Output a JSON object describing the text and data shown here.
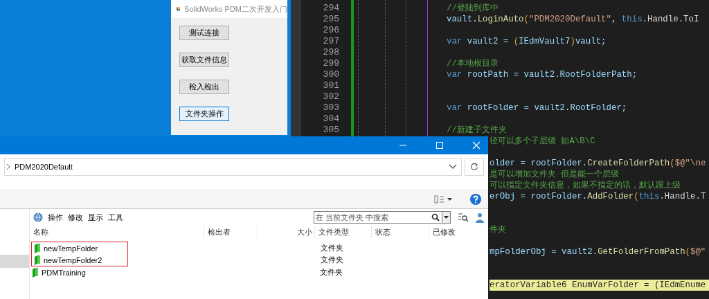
{
  "form_window": {
    "title": "SolidWorks PDM二次开发入门",
    "buttons": [
      {
        "label": "测试连接",
        "focused": false
      },
      {
        "label": "获取文件信息",
        "focused": false
      },
      {
        "label": "检入检出",
        "focused": false
      },
      {
        "label": "文件夹操作",
        "focused": true
      }
    ]
  },
  "code_editor": {
    "lines": [
      {
        "number": "294",
        "tokens": [
          {
            "text": "//登陆到库中",
            "kind": "comment"
          }
        ]
      },
      {
        "number": "295",
        "tokens": [
          {
            "text": "vault",
            "kind": "ident"
          },
          {
            "text": ".",
            "kind": "plain"
          },
          {
            "text": "LoginAuto",
            "kind": "method"
          },
          {
            "text": "(",
            "kind": "paren"
          },
          {
            "text": "\"PDM2020Default\"",
            "kind": "string"
          },
          {
            "text": ", ",
            "kind": "plain"
          },
          {
            "text": "this",
            "kind": "keyword"
          },
          {
            "text": ".Handle.ToI",
            "kind": "plain"
          }
        ]
      },
      {
        "number": "296"
      },
      {
        "number": "297",
        "tokens": [
          {
            "text": "var",
            "kind": "keyword"
          },
          {
            "text": " vault2 = ",
            "kind": "ident"
          },
          {
            "text": "(",
            "kind": "paren"
          },
          {
            "text": "IEdmVault7",
            "kind": "ident"
          },
          {
            "text": ")",
            "kind": "paren"
          },
          {
            "text": "vault;",
            "kind": "ident"
          }
        ]
      },
      {
        "number": "298"
      },
      {
        "number": "299",
        "tokens": [
          {
            "text": "//本地根目录",
            "kind": "comment"
          }
        ]
      },
      {
        "number": "300",
        "tokens": [
          {
            "text": "var",
            "kind": "keyword"
          },
          {
            "text": " rootPath = vault2.RootFolderPath;",
            "kind": "ident"
          }
        ]
      },
      {
        "number": "301"
      },
      {
        "number": "302"
      },
      {
        "number": "303",
        "tokens": [
          {
            "text": "var",
            "kind": "keyword"
          },
          {
            "text": " rootFolder = vault2.RootFolder;",
            "kind": "ident"
          }
        ]
      },
      {
        "number": "304"
      },
      {
        "number": "305",
        "tokens": [
          {
            "text": "//新建子文件夹",
            "kind": "comment"
          }
        ]
      }
    ],
    "partial_lines": [
      {
        "highlighted": false,
        "tokens": [
          {
            "text": "径可以多个子层级 如A\\B\\C",
            "kind": "comment"
          }
        ]
      },
      {
        "highlighted": false,
        "tokens": [
          {
            "text": "older = rootFolder.",
            "kind": "ident"
          },
          {
            "text": "CreateFolderPath",
            "kind": "method"
          },
          {
            "text": "(",
            "kind": "paren"
          },
          {
            "text": "$@\"\\ne",
            "kind": "string"
          }
        ]
      },
      {
        "highlighted": false,
        "tokens": [
          {
            "text": "是可以增加文件夹 但是能一个层级",
            "kind": "comment"
          }
        ]
      },
      {
        "highlighted": false,
        "tokens": [
          {
            "text": "可以指定文件夹信息，如果不指定的话，默认跟上级",
            "kind": "comment"
          }
        ]
      },
      {
        "highlighted": false,
        "tokens": [
          {
            "text": "erObj = rootFolder.",
            "kind": "ident"
          },
          {
            "text": "AddFolder",
            "kind": "method"
          },
          {
            "text": "(",
            "kind": "paren"
          },
          {
            "text": "this",
            "kind": "keyword"
          },
          {
            "text": ".Handle.T",
            "kind": "plain"
          }
        ]
      },
      {
        "highlighted": false,
        "tokens": [
          {
            "text": "件夹",
            "kind": "comment"
          }
        ]
      },
      {
        "highlighted": false,
        "tokens": [
          {
            "text": "mpFolderObj = vault2.",
            "kind": "ident"
          },
          {
            "text": "GetFolderFromPath",
            "kind": "method"
          },
          {
            "text": "(",
            "kind": "paren"
          },
          {
            "text": "$@\"",
            "kind": "string"
          }
        ]
      },
      {
        "highlighted": true,
        "tokens": [
          {
            "text": "eratorVariable6 EnumVarFolder = (IEdmEnume",
            "kind": "plain"
          }
        ]
      }
    ]
  },
  "explorer_window": {
    "address": "PDM2020Default",
    "menu": [
      "操作",
      "修改",
      "显示",
      "工具"
    ],
    "search": {
      "placeholder": "在 当前文件夹 中搜索"
    },
    "columns": [
      "名称",
      "检出者",
      "大小",
      "文件类型",
      "状态",
      "已修改"
    ],
    "rows": [
      {
        "name": "newTempFolder",
        "type": "文件夹",
        "highlighted": true
      },
      {
        "name": "newTempFolder2",
        "type": "文件夹",
        "highlighted": true
      },
      {
        "name": "PDMTraining",
        "type": "文件夹",
        "highlighted": false
      }
    ]
  }
}
